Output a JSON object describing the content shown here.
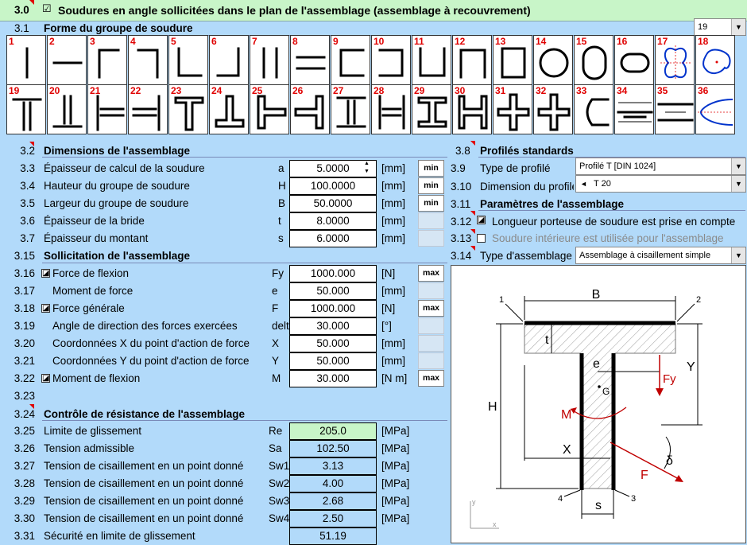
{
  "header": {
    "num": "3.0",
    "title": "Soudures en angle sollicitées dans le plan de l'assemblage (assemblage à recouvrement)",
    "checked": "☑",
    "select_value": "19",
    "select_arrow": "▼"
  },
  "forme": {
    "num": "3.1",
    "title": "Forme du groupe de soudure",
    "tiles": [
      "1",
      "2",
      "3",
      "4",
      "5",
      "6",
      "7",
      "8",
      "9",
      "10",
      "11",
      "12",
      "13",
      "14",
      "15",
      "16",
      "17",
      "18",
      "19",
      "20",
      "21",
      "22",
      "23",
      "24",
      "25",
      "26",
      "27",
      "28",
      "29",
      "30",
      "31",
      "32",
      "33",
      "34",
      "35",
      "36"
    ]
  },
  "dims": {
    "num": "3.2",
    "title": "Dimensions de l'assemblage",
    "rows": [
      {
        "num": "3.3",
        "label": "Épaisseur de calcul de la soudure",
        "sym": "a",
        "value": "5.0000",
        "unit": "[mm]",
        "btn": "min"
      },
      {
        "num": "3.4",
        "label": "Hauteur du groupe de soudure",
        "sym": "H",
        "value": "100.0000",
        "unit": "[mm]",
        "btn": "min"
      },
      {
        "num": "3.5",
        "label": "Largeur du groupe de soudure",
        "sym": "B",
        "value": "50.0000",
        "unit": "[mm]",
        "btn": "min"
      },
      {
        "num": "3.6",
        "label": "Épaisseur de la bride",
        "sym": "t",
        "value": "8.0000",
        "unit": "[mm]",
        "btn": ""
      },
      {
        "num": "3.7",
        "label": "Épaisseur du montant",
        "sym": "s",
        "value": "6.0000",
        "unit": "[mm]",
        "btn": ""
      }
    ]
  },
  "load": {
    "num": "3.15",
    "title": "Sollicitation de l'assemblage",
    "rows": [
      {
        "num": "3.16",
        "label": "Force de flexion",
        "sym": "Fy",
        "value": "1000.000",
        "unit": "[N]",
        "btn": "max",
        "icon": true
      },
      {
        "num": "3.17",
        "label": "Moment de force",
        "sym": "e",
        "value": "50.000",
        "unit": "[mm]",
        "btn": "",
        "icon": false
      },
      {
        "num": "3.18",
        "label": "Force générale",
        "sym": "F",
        "value": "1000.000",
        "unit": "[N]",
        "btn": "max",
        "icon": true
      },
      {
        "num": "3.19",
        "label": "Angle de direction des forces exercées",
        "sym": "delta",
        "value": "30.000",
        "unit": "[°]",
        "btn": "",
        "icon": false
      },
      {
        "num": "3.20",
        "label": "Coordonnées X du point d'action de force",
        "sym": "X",
        "value": "50.000",
        "unit": "[mm]",
        "btn": "",
        "icon": false
      },
      {
        "num": "3.21",
        "label": "Coordonnées Y du point d'action de force",
        "sym": "Y",
        "value": "50.000",
        "unit": "[mm]",
        "btn": "",
        "icon": false
      },
      {
        "num": "3.22",
        "label": "Moment de flexion",
        "sym": "M",
        "value": "30.000",
        "unit": "[N m]",
        "btn": "max",
        "icon": true
      }
    ],
    "empty_num": "3.23"
  },
  "check": {
    "num": "3.24",
    "title": "Contrôle de résistance de l'assemblage",
    "rows": [
      {
        "num": "3.25",
        "label": "Limite de glissement",
        "sym": "Re",
        "value": "205.0",
        "unit": "[MPa]"
      },
      {
        "num": "3.26",
        "label": "Tension admissible",
        "sym": "Sa",
        "value": "102.50",
        "unit": "[MPa]"
      },
      {
        "num": "3.27",
        "label": "Tension de cisaillement en un point donné",
        "sym": "Sw1",
        "value": "3.13",
        "unit": "[MPa]"
      },
      {
        "num": "3.28",
        "label": "Tension de cisaillement en un point donné",
        "sym": "Sw2",
        "value": "4.00",
        "unit": "[MPa]"
      },
      {
        "num": "3.29",
        "label": "Tension de cisaillement en un point donné",
        "sym": "Sw3",
        "value": "2.68",
        "unit": "[MPa]"
      },
      {
        "num": "3.30",
        "label": "Tension de cisaillement en un point donné",
        "sym": "Sw4",
        "value": "2.50",
        "unit": "[MPa]"
      },
      {
        "num": "3.31",
        "label": "Sécurité en limite de glissement",
        "sym": "",
        "value": "51.19",
        "unit": ""
      }
    ]
  },
  "profiles": {
    "num": "3.8",
    "title": "Profilés standards",
    "type_num": "3.9",
    "type_label": "Type de profilé",
    "type_value": "Profilé T  [DIN 1024]",
    "dim_num": "3.10",
    "dim_label": "Dimension du profilé",
    "dim_value": "T 20"
  },
  "params": {
    "num": "3.11",
    "title": "Paramètres de l'assemblage",
    "r1_num": "3.12",
    "r1_label": "Longueur porteuse de soudure est prise en compte",
    "r2_num": "3.13",
    "r2_label": "Soudure intérieure est utilisée pour l'assemblage",
    "r3_num": "3.14",
    "r3_label": "Type d'assemblage",
    "r3_value": "Assemblage à cisaillement simple"
  },
  "diagram": {
    "B": "B",
    "t": "t",
    "e": "e",
    "Fy": "Fy",
    "Y": "Y",
    "G": "G",
    "H": "H",
    "M": "M",
    "X": "X",
    "delta": "δ",
    "F": "F",
    "s": "s",
    "p1": "1",
    "p2": "2",
    "p3": "3",
    "p4": "4",
    "ax_y": "y",
    "ax_x": "x"
  },
  "colors": {
    "bg": "#b2dafa",
    "header": "#c8f5c8",
    "accent_red": "#e00000",
    "highlight_cell": "#c8f5c8"
  }
}
